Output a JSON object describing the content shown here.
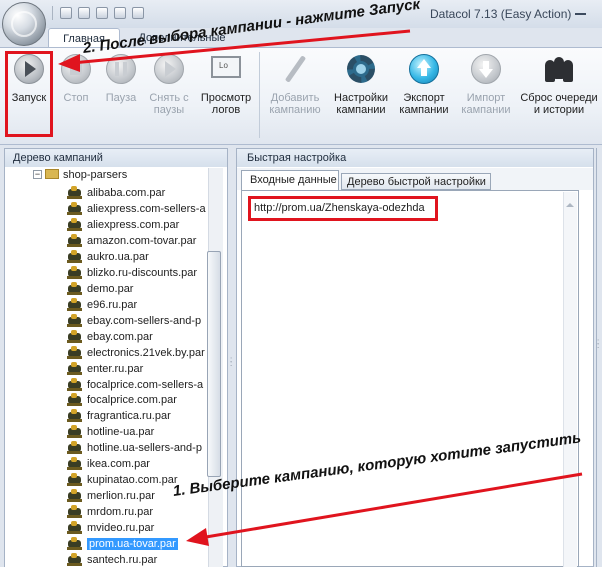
{
  "window": {
    "title": "Datacol 7.13 (Easy Action)"
  },
  "ribbon": {
    "tabs": [
      {
        "label": "Главная",
        "active": true
      },
      {
        "label": "Дополнительные",
        "active": false
      }
    ],
    "buttons": {
      "run": "Запуск",
      "stop": "Стоп",
      "pause": "Пауза",
      "unpause": "Снять с\nпаузы",
      "view_logs": "Просмотр\nлогов",
      "add_campaign": "Добавить\nкампанию",
      "campaign_settings": "Настройки\nкампании",
      "export_campaign": "Экспорт\nкампании",
      "import_campaign": "Импорт\nкампании",
      "reset_queue": "Сброс очереди\nи истории"
    }
  },
  "left_panel": {
    "title": "Дерево кампаний",
    "root_folder": "shop-parsers",
    "items": [
      "alibaba.com.par",
      "aliexpress.com-sellers-a",
      "aliexpress.com.par",
      "amazon.com-tovar.par",
      "aukro.ua.par",
      "blizko.ru-discounts.par",
      "demo.par",
      "e96.ru.par",
      "ebay.com-sellers-and-p",
      "ebay.com.par",
      "electronics.21vek.by.par",
      "enter.ru.par",
      "focalprice.com-sellers-a",
      "focalprice.com.par",
      "fragrantica.ru.par",
      "hotline-ua.par",
      "hotline.ua-sellers-and-p",
      "ikea.com.par",
      "kupinatao.com.par",
      "merlion.ru.par",
      "mrdom.ru.par",
      "mvideo.ru.par",
      "prom.ua-tovar.par",
      "santech.ru.par"
    ],
    "selected_item": "prom.ua-tovar.par"
  },
  "right_panel": {
    "title": "Быстрая настройка",
    "tabs": [
      "Входные данные",
      "Дерево быстрой настройки"
    ],
    "input_data": "http://prom.ua/Zhenskaya-odezhda"
  },
  "annotations": {
    "step1": "1. Выберите кампанию, которую хотите запустить",
    "step2": "2. После выбора кампании - нажмите Запуск"
  },
  "colors": {
    "highlight": "#e0141e",
    "selection": "#3399ff",
    "ribbon_bg": "#eef2f7"
  }
}
